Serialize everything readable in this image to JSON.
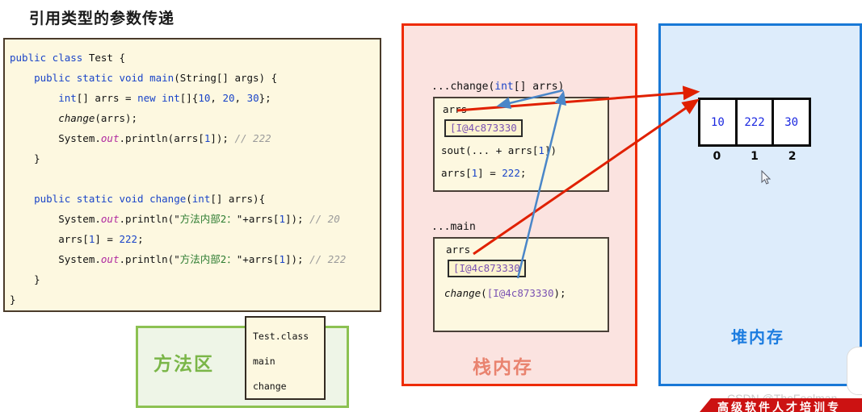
{
  "page": {
    "title": "引用类型的参数传递"
  },
  "code_panel": {
    "lines": [
      [
        {
          "t": "public class ",
          "c": "kw"
        },
        {
          "t": "Test {",
          "c": ""
        }
      ],
      [
        {
          "t": "    public static void ",
          "c": "kw"
        },
        {
          "t": "main",
          "c": "kw"
        },
        {
          "t": "(String[] args) {",
          "c": ""
        }
      ],
      [
        {
          "t": "        ",
          "c": ""
        },
        {
          "t": "int",
          "c": "kw"
        },
        {
          "t": "[] arrs = ",
          "c": ""
        },
        {
          "t": "new int",
          "c": "kw"
        },
        {
          "t": "[]{",
          "c": ""
        },
        {
          "t": "10",
          "c": "num"
        },
        {
          "t": ", ",
          "c": ""
        },
        {
          "t": "20",
          "c": "num"
        },
        {
          "t": ", ",
          "c": ""
        },
        {
          "t": "30",
          "c": "num"
        },
        {
          "t": "};",
          "c": ""
        }
      ],
      [
        {
          "t": "        ",
          "c": ""
        },
        {
          "t": "change",
          "c": "it"
        },
        {
          "t": "(arrs);",
          "c": ""
        }
      ],
      [
        {
          "t": "        System.",
          "c": ""
        },
        {
          "t": "out",
          "c": "fld"
        },
        {
          "t": ".println(arrs[",
          "c": ""
        },
        {
          "t": "1",
          "c": "num"
        },
        {
          "t": "]); ",
          "c": ""
        },
        {
          "t": "// 222",
          "c": "cm"
        }
      ],
      [
        {
          "t": "    }",
          "c": ""
        }
      ],
      [
        {
          "t": " ",
          "c": ""
        }
      ],
      [
        {
          "t": "    public static void ",
          "c": "kw"
        },
        {
          "t": "change",
          "c": "kw"
        },
        {
          "t": "(",
          "c": ""
        },
        {
          "t": "int",
          "c": "kw"
        },
        {
          "t": "[] arrs){",
          "c": ""
        }
      ],
      [
        {
          "t": "        System.",
          "c": ""
        },
        {
          "t": "out",
          "c": "fld"
        },
        {
          "t": ".println(\"",
          "c": ""
        },
        {
          "t": "方法内部2：",
          "c": "str"
        },
        {
          "t": "\"+arrs[",
          "c": ""
        },
        {
          "t": "1",
          "c": "num"
        },
        {
          "t": "]); ",
          "c": ""
        },
        {
          "t": "// 20",
          "c": "cm"
        }
      ],
      [
        {
          "t": "        arrs[",
          "c": ""
        },
        {
          "t": "1",
          "c": "num"
        },
        {
          "t": "] = ",
          "c": ""
        },
        {
          "t": "222",
          "c": "num"
        },
        {
          "t": ";",
          "c": ""
        }
      ],
      [
        {
          "t": "        System.",
          "c": ""
        },
        {
          "t": "out",
          "c": "fld"
        },
        {
          "t": ".println(\"",
          "c": ""
        },
        {
          "t": "方法内部2：",
          "c": "str"
        },
        {
          "t": "\"+arrs[",
          "c": ""
        },
        {
          "t": "1",
          "c": "num"
        },
        {
          "t": "]); ",
          "c": ""
        },
        {
          "t": "// 222",
          "c": "cm"
        }
      ],
      [
        {
          "t": "    }",
          "c": ""
        },
        {
          "t": "",
          "c": ""
        }
      ],
      [
        {
          "t": "}",
          "c": ""
        }
      ]
    ]
  },
  "method_area": {
    "label": "方法区",
    "class_box": {
      "entries": [
        "Test.class",
        "main",
        "change"
      ]
    }
  },
  "stack": {
    "label": "栈内存",
    "border_color": "#ee2b00",
    "background_color": "#fbe3e0",
    "frames": [
      {
        "title": "...change(int[] arrs)",
        "var_name": "arrs",
        "address": "[I@4c873330",
        "lines": [
          "sout(... + arrs[1])",
          "arrs[1] = 222;"
        ]
      },
      {
        "title": "...main",
        "var_name": "arrs",
        "address": "[I@4c873330",
        "lines": [
          "change([I@4c873330);"
        ]
      }
    ]
  },
  "heap": {
    "label": "堆内存",
    "border_color": "#1878d6",
    "background_color": "#ddecfb",
    "array": {
      "values": [
        "10",
        "222",
        "30"
      ],
      "indices": [
        "0",
        "1",
        "2"
      ]
    }
  },
  "watermark": {
    "text": "CSDN @TheFoolman",
    "banner_text": "高级软件人才培训专"
  }
}
